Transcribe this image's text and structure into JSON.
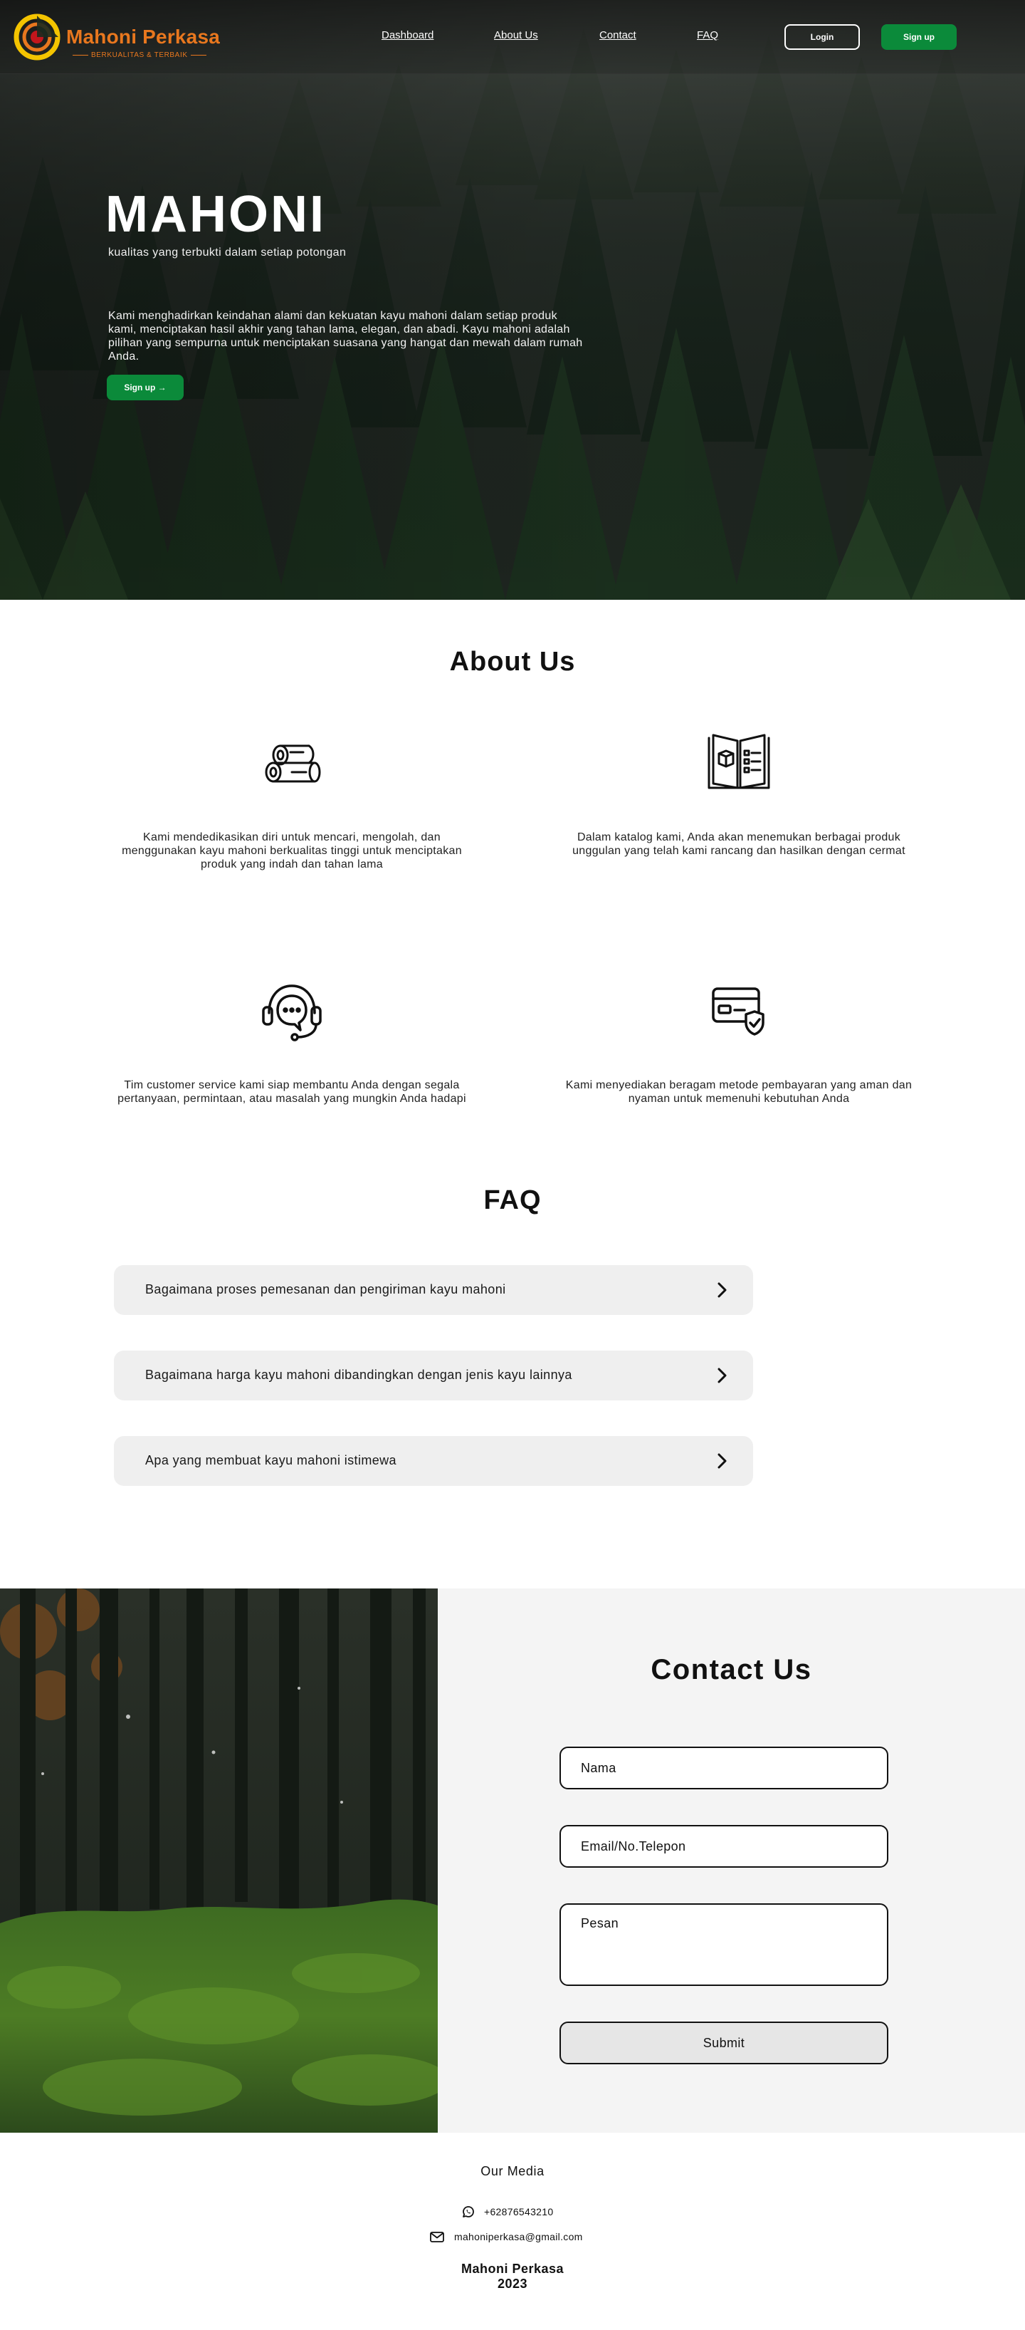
{
  "header": {
    "brand_name": "Mahoni Perkasa",
    "brand_tagline": "BERKUALITAS & TERBAIK",
    "nav": [
      {
        "label": "Dashboard"
      },
      {
        "label": "About Us"
      },
      {
        "label": "Contact"
      },
      {
        "label": "FAQ"
      }
    ],
    "login_label": "Login",
    "signup_label": "Sign up"
  },
  "hero": {
    "title": "MAHONI",
    "subtitle": "kualitas yang terbukti dalam setiap potongan",
    "description": "Kami menghadirkan keindahan alami dan kekuatan kayu mahoni dalam setiap produk kami, menciptakan hasil akhir yang tahan lama, elegan, dan abadi. Kayu mahoni adalah pilihan yang sempurna untuk menciptakan suasana yang hangat dan mewah dalam rumah Anda.",
    "cta_label": "Sign up →"
  },
  "about": {
    "title": "About Us",
    "features": [
      {
        "icon": "wood-logs-icon",
        "text": "Kami mendedikasikan diri untuk mencari, mengolah, dan menggunakan kayu mahoni berkualitas tinggi untuk menciptakan produk yang indah dan tahan lama"
      },
      {
        "icon": "catalog-book-icon",
        "text": "Dalam katalog kami, Anda akan menemukan berbagai produk unggulan yang telah kami rancang dan hasilkan dengan cermat"
      },
      {
        "icon": "customer-service-headset-icon",
        "text": "Tim customer service kami siap membantu Anda dengan segala pertanyaan, permintaan, atau masalah yang mungkin Anda hadapi"
      },
      {
        "icon": "secure-payment-card-icon",
        "text": "Kami menyediakan beragam metode pembayaran yang aman dan nyaman untuk memenuhi kebutuhan Anda"
      }
    ]
  },
  "faq": {
    "title": "FAQ",
    "items": [
      {
        "question": "Bagaimana proses pemesanan dan pengiriman kayu mahoni"
      },
      {
        "question": "Bagaimana harga kayu mahoni dibandingkan dengan jenis kayu lainnya"
      },
      {
        "question": "Apa yang membuat kayu mahoni istimewa"
      }
    ]
  },
  "contact": {
    "title": "Contact Us",
    "name_placeholder": "Nama",
    "email_placeholder": "Email/No.Telepon",
    "message_placeholder": "Pesan",
    "submit_label": "Submit"
  },
  "footer": {
    "media_title": "Our Media",
    "phone": "+62876543210",
    "email": "mahoniperkasa@gmail.com",
    "brand": "Mahoni Perkasa",
    "year": "2023"
  },
  "colors": {
    "accent_green": "#0b8a3a",
    "brand_orange": "#e8771e",
    "faq_bg": "#efefef",
    "contact_bg": "#f4f4f4"
  }
}
